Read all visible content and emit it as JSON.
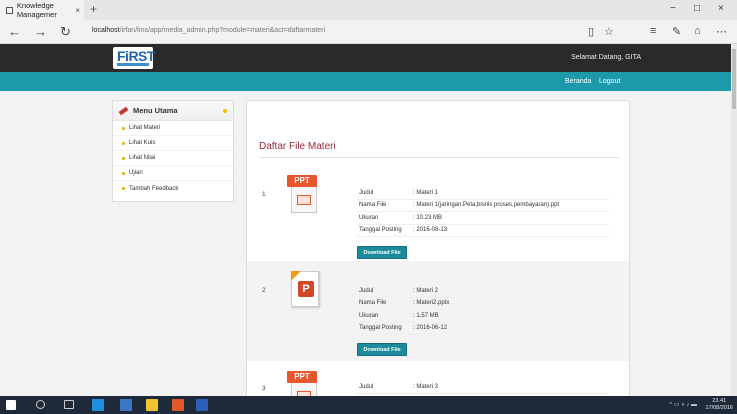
{
  "browser": {
    "tab_title": "Knowledge Managemer",
    "tab_close": "×",
    "new_tab": "+",
    "url_host": "localhost",
    "url_path": "/irfan/lms/app/media_admin.php?module=materi&act=daftarmateri",
    "back": "←",
    "forward": "→",
    "refresh": "↻",
    "minimize": "−",
    "maximize": "□",
    "close": "×"
  },
  "site": {
    "logo_text": "FiRST",
    "greeting": "Selamat Datang, GITA",
    "nav": [
      "Beranda",
      "Logout"
    ]
  },
  "sidebar": {
    "title": "Menu Utama",
    "items": [
      "Lihat Materi",
      "Lihat Kuis",
      "Lihat Nilai",
      "Ujian",
      "Tambah Feedback"
    ]
  },
  "main": {
    "title": "Daftar File Materi",
    "labels": {
      "judul": "Judul",
      "nama_file": "Nama File",
      "ukuran": "Ukuran",
      "tanggal": "Tanggal Posting"
    },
    "download_label": "Download File",
    "files": [
      {
        "num": "1",
        "icon": "ppt-icon",
        "judul": ": Materi 1",
        "nama_file": ": Materi 1(jaringan,Peta,bisnis proses,pembayaran).ppt",
        "ukuran": ": 10.23 MB",
        "tanggal": ": 2016-08-13"
      },
      {
        "num": "2",
        "icon": "pptx-icon",
        "judul": ": Materi 2",
        "nama_file": ": Materi2.pptx",
        "ukuran": ": 1.57 MB",
        "tanggal": ": 2016-06-12"
      },
      {
        "num": "3",
        "icon": "ppt-icon",
        "judul": ": Materi 3"
      }
    ]
  },
  "taskbar": {
    "time": "23.41",
    "date": "17/08/2016"
  }
}
